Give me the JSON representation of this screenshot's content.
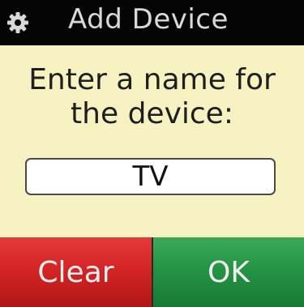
{
  "header": {
    "title": "Add Device",
    "icon": "gear-icon"
  },
  "main": {
    "prompt_line1": "Enter a name for",
    "prompt_line2": "the device:",
    "device_name": {
      "value": "TV"
    }
  },
  "footer": {
    "clear_label": "Clear",
    "ok_label": "OK"
  },
  "colors": {
    "header_bg": "#050505",
    "body_bg": "#f7f2c1",
    "clear_button": "#d42525",
    "ok_button": "#259344"
  }
}
